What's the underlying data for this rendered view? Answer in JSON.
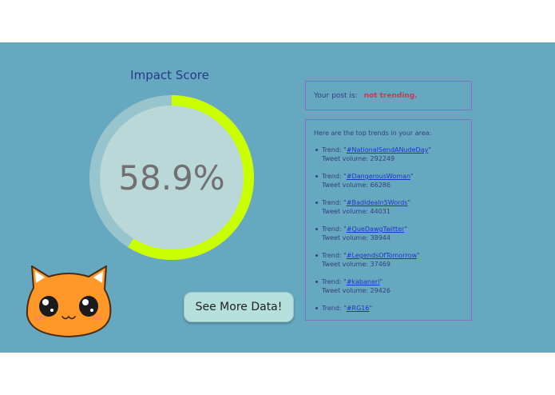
{
  "impact": {
    "title": "Impact Score",
    "score_text": "58.9%",
    "score_fraction": 0.589,
    "colors": {
      "track": "#98c4cd",
      "progress": "#c9ff00",
      "inner": "#bad8d7",
      "text": "#707070"
    }
  },
  "button": {
    "label": "See More Data!"
  },
  "status": {
    "label": "Your post is:",
    "value": "not trending."
  },
  "trends": {
    "heading": "Here are the top trends in your area:",
    "trend_label": "Trend:",
    "volume_label": "Tweet volume:",
    "items": [
      {
        "name": "#NationalSendANudeDay",
        "volume": "292249"
      },
      {
        "name": "#DangerousWoman",
        "volume": "66286"
      },
      {
        "name": "#BadIdeaIn5Words",
        "volume": "44031"
      },
      {
        "name": "#QueDawgTwitter",
        "volume": "38944"
      },
      {
        "name": "#LegendsOfTomorrow",
        "volume": "37469"
      },
      {
        "name": "#kabaneri",
        "volume": "29426"
      },
      {
        "name": "#RG16",
        "volume": ""
      }
    ]
  },
  "mascot": {
    "icon": "orange-cat-mascot-icon",
    "colors": {
      "fur": "#ff9827",
      "outline": "#4a2c12",
      "ear_inner": "#ffffff",
      "blush": "#ff7d6a"
    }
  },
  "colors": {
    "background": "#67a8c1",
    "accent_red": "#d13555",
    "panel_border": "#7f72c4",
    "link": "#1c34c9"
  }
}
